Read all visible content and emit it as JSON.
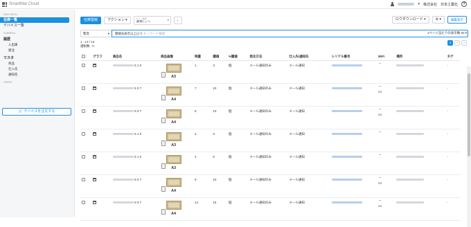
{
  "header": {
    "app_name": "SmartMat Cloud",
    "company": "株式会社",
    "user_name": "日本工業社",
    "help": "?"
  },
  "sidebar": {
    "section1": "MAIN MENU",
    "items": [
      {
        "label": "在庫一覧"
      },
      {
        "label": "デバイス一覧"
      }
    ],
    "section2": "SUBMENU",
    "groups": [
      {
        "label": "履歴",
        "subs": [
          "入出庫",
          "発注"
        ]
      },
      {
        "label": "マスタ",
        "subs": [
          "商品",
          "仕入先",
          "通知先"
        ]
      }
    ],
    "section3": "ORDER",
    "order_button": "デバイスを注文する"
  },
  "toolbar": {
    "primary": "在庫登録",
    "action": "アクション",
    "view_label": "ビュー選択",
    "view_value": "(新規ビュー)",
    "view_plus": "+",
    "download": "ロウダウンロード",
    "settings": "⚙",
    "edit_mode": "編集表示"
  },
  "search": {
    "select": "緊急",
    "value": "閾値을表示以上(1つ",
    "placeholder": "キーワード検索",
    "per_page": "1ページ当たりの表示数 50"
  },
  "counts": {
    "range": "1 - 13 / 13",
    "selected": "選択数 : 0"
  },
  "pager": {
    "current": "1",
    "prev": "‹",
    "next": "›"
  },
  "columns": [
    "グラフ",
    "商品名",
    "商品画像",
    "残量",
    "閾値",
    "%閾値",
    "発注方法",
    "仕入先/通知先",
    "シリアル番号",
    "WiFi",
    "場所",
    "タグ"
  ],
  "rows": [
    {
      "name_tail": "5 1 0",
      "size": "A3",
      "qty": "1",
      "th": "3",
      "pct": "個",
      "method": "メール通知のみ",
      "notify": "メール通知",
      "wifi_count": "",
      "tag": "-"
    },
    {
      "name_tail": "5 0 7",
      "size": "A4",
      "qty": "7",
      "th": "10",
      "pct": "個",
      "method": "メール通知のみ",
      "notify": "メール通知",
      "wifi_count": "2/2",
      "tag": "-"
    },
    {
      "name_tail": "5 0 7",
      "size": "A4",
      "qty": "5",
      "th": "10",
      "pct": "個",
      "method": "メール通知のみ",
      "notify": "メール通知",
      "wifi_count": "2/2",
      "tag": "-"
    },
    {
      "name_tail": "5 1 0",
      "size": "A3",
      "qty": "2",
      "th": "3",
      "pct": "個",
      "method": "メール通知のみ",
      "notify": "メール通知",
      "wifi_count": "",
      "tag": "-"
    },
    {
      "name_tail": "5 1 0",
      "size": "A3",
      "qty": "4",
      "th": "6",
      "pct": "個",
      "method": "メール通知のみ",
      "notify": "メール通知",
      "wifi_count": "",
      "tag": "-"
    },
    {
      "name_tail": "5 0 7",
      "size": "A4",
      "qty": "9",
      "th": "10",
      "pct": "個",
      "method": "メール通知のみ",
      "notify": "メール通知",
      "wifi_count": "2/2",
      "tag": "-"
    },
    {
      "name_tail": "5 0 7",
      "size": "A4",
      "qty": "14",
      "th": "15",
      "pct": "個",
      "method": "メール通知のみ",
      "notify": "メール通知",
      "wifi_count": "2/2",
      "tag": "-"
    }
  ]
}
